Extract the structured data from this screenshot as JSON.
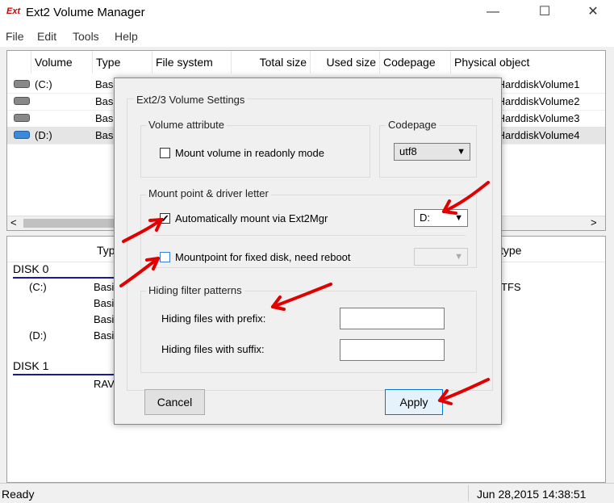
{
  "window": {
    "title": "Ext2 Volume Manager",
    "icon_text": "Ext",
    "minimize": "—",
    "maximize": "☐",
    "close": "✕"
  },
  "menu": [
    "File",
    "Edit",
    "Tools",
    "Help"
  ],
  "volumes_table": {
    "columns": [
      "Volume",
      "Type",
      "File system",
      "Total size",
      "Used size",
      "Codepage",
      "Physical object"
    ],
    "rows": [
      {
        "volume": "(C:)",
        "type": "Bas",
        "physical": "\\HarddiskVolume1",
        "icon": "gray-disk-icon",
        "selected": false
      },
      {
        "volume": "",
        "type": "Bas",
        "physical": "\\HarddiskVolume2",
        "icon": "gray-disk-icon",
        "selected": false
      },
      {
        "volume": "",
        "type": "Bas",
        "physical": "\\HarddiskVolume3",
        "icon": "gray-disk-icon",
        "selected": false
      },
      {
        "volume": "(D:)",
        "type": "Bas",
        "physical": "\\HarddiskVolume4",
        "icon": "blue-disk-icon",
        "selected": true
      }
    ],
    "scroll_left": "<",
    "scroll_right": ">"
  },
  "disks_table": {
    "col_type": "Typ",
    "col_fstype": "type",
    "disk0": {
      "label": "DISK 0",
      "rows": [
        {
          "volume": "(C:)",
          "type": "Basi",
          "fs": "TFS"
        },
        {
          "volume": "",
          "type": "Basi",
          "fs": ""
        },
        {
          "volume": "",
          "type": "Basi",
          "fs": ""
        },
        {
          "volume": "(D:)",
          "type": "Basi",
          "fs": ""
        }
      ]
    },
    "disk1": {
      "label": "DISK 1",
      "rows": [
        {
          "volume": "",
          "type": "RAV",
          "fs": ""
        }
      ]
    }
  },
  "status": {
    "left": "Ready",
    "right": "Jun 28,2015 14:38:51"
  },
  "dialog": {
    "title": "Ext2/3 Volume Settings",
    "volume_attribute": {
      "label": "Volume attribute",
      "readonly_label": "Mount volume in readonly mode",
      "readonly_checked": false
    },
    "codepage": {
      "label": "Codepage",
      "value": "utf8"
    },
    "mount": {
      "label": "Mount point & driver letter",
      "auto_label": "Automatically mount via Ext2Mgr",
      "auto_checked": true,
      "drive_letter": "D:",
      "fixed_label": "Mountpoint for fixed disk, need reboot",
      "fixed_checked": false,
      "fixed_value": ""
    },
    "hiding": {
      "label": "Hiding filter patterns",
      "prefix_label": "Hiding files with prefix:",
      "prefix_value": "",
      "suffix_label": "Hiding files with suffix:",
      "suffix_value": ""
    },
    "cancel": "Cancel",
    "apply": "Apply"
  },
  "colors": {
    "annotation_arrow": "#e00000",
    "disk_line": "#1a1aa0",
    "selected_row": "#e5e5e5",
    "apply_border": "#0078d7"
  }
}
